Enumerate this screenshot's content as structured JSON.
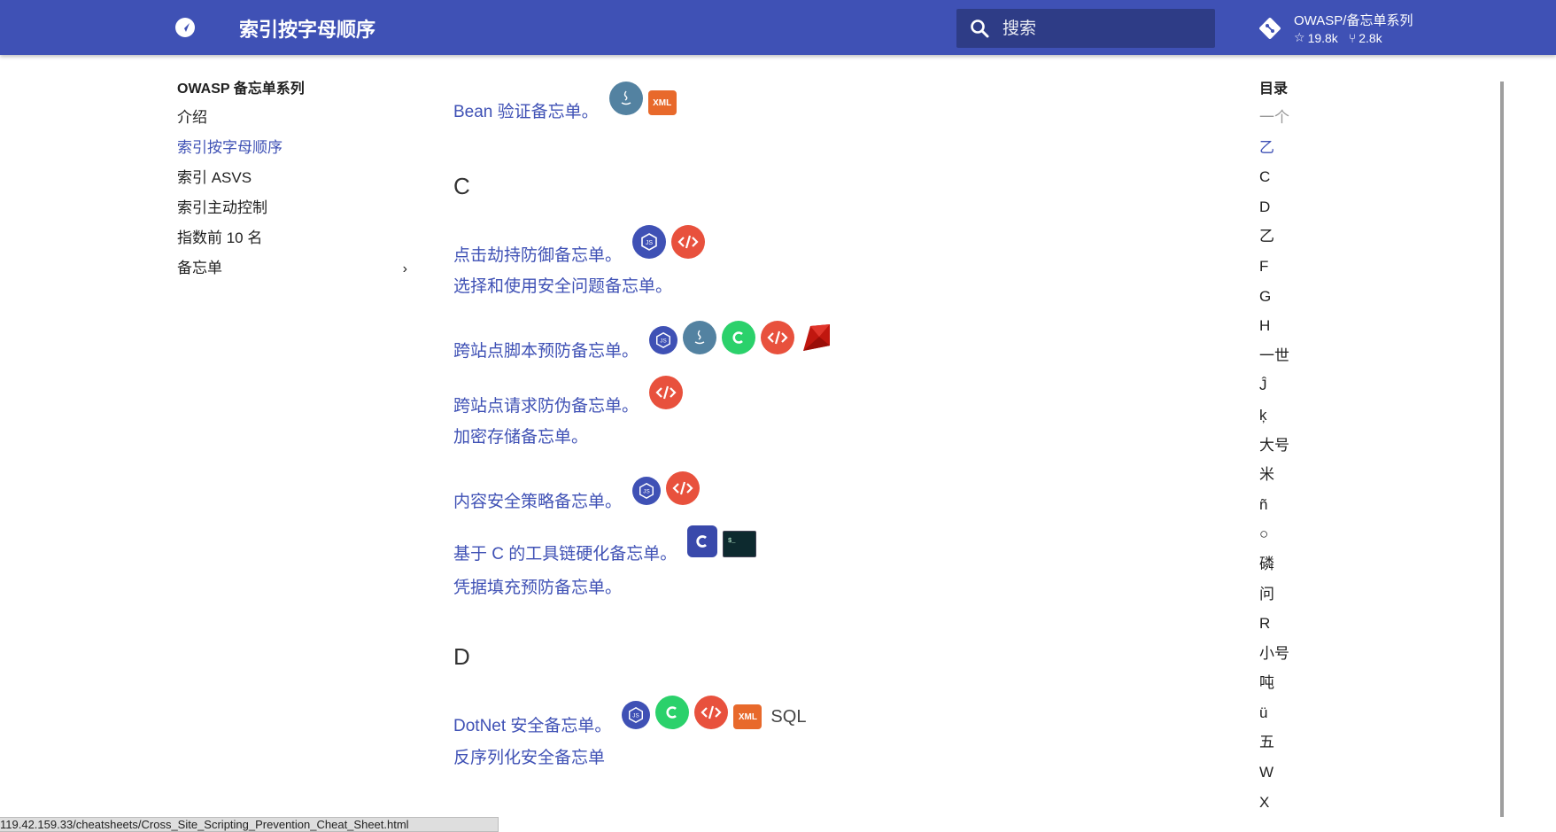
{
  "header": {
    "title": "索引按字母顺序",
    "search_placeholder": "搜索",
    "repo_name": "OWASP/备忘单系列",
    "stars": "19.8k",
    "forks": "2.8k"
  },
  "sidebar": {
    "title": "OWASP 备忘单系列",
    "items": [
      {
        "label": "介绍"
      },
      {
        "label": "索引按字母顺序"
      },
      {
        "label": "索引 ASVS"
      },
      {
        "label": "索引主动控制"
      },
      {
        "label": "指数前 10 名"
      },
      {
        "label": "备忘单"
      }
    ]
  },
  "content": {
    "letter_c": "C",
    "letter_d": "D",
    "entries": [
      {
        "label": "Bean 验证备忘单。",
        "badges": [
          "java",
          "xml"
        ]
      },
      {
        "label": "点击劫持防御备忘单。",
        "badges": [
          "js",
          "html"
        ]
      },
      {
        "label": "选择和使用安全问题备忘单。",
        "badges": []
      },
      {
        "label": "跨站点脚本预防备忘单。",
        "badges": [
          "js",
          "java",
          "csharp",
          "html",
          "ruby"
        ]
      },
      {
        "label": "跨站点请求防伪备忘单。",
        "badges": [
          "html"
        ]
      },
      {
        "label": "加密存储备忘单。",
        "badges": []
      },
      {
        "label": "内容安全策略备忘单。",
        "badges": [
          "js",
          "html"
        ]
      },
      {
        "label": "基于 C 的工具链硬化备忘单。",
        "badges": [
          "c",
          "terminal"
        ]
      },
      {
        "label": "凭据填充预防备忘单。",
        "badges": []
      },
      {
        "label": "DotNet 安全备忘单。",
        "badges": [
          "js",
          "csharp",
          "html",
          "xml",
          "sql"
        ]
      },
      {
        "label": "反序列化安全备忘单",
        "badges": []
      }
    ],
    "xml_text": "XML",
    "sql_text": "SQL"
  },
  "toc": {
    "title": "目录",
    "items": [
      "一个",
      "乙",
      "C",
      "D",
      "乙",
      "F",
      "G",
      "H",
      "一世",
      "Ĵ",
      "ķ",
      "大号",
      "米",
      "ñ",
      "○",
      "磷",
      "问",
      "R",
      "小号",
      "吨",
      "ü",
      "五",
      "W",
      "X"
    ]
  },
  "statusbar": {
    "url": "119.42.159.33/cheatsheets/Cross_Site_Scripting_Prevention_Cheat_Sheet.html"
  },
  "colors": {
    "primary": "#3f51b5",
    "link": "#3f51b5",
    "text": "#212121"
  }
}
